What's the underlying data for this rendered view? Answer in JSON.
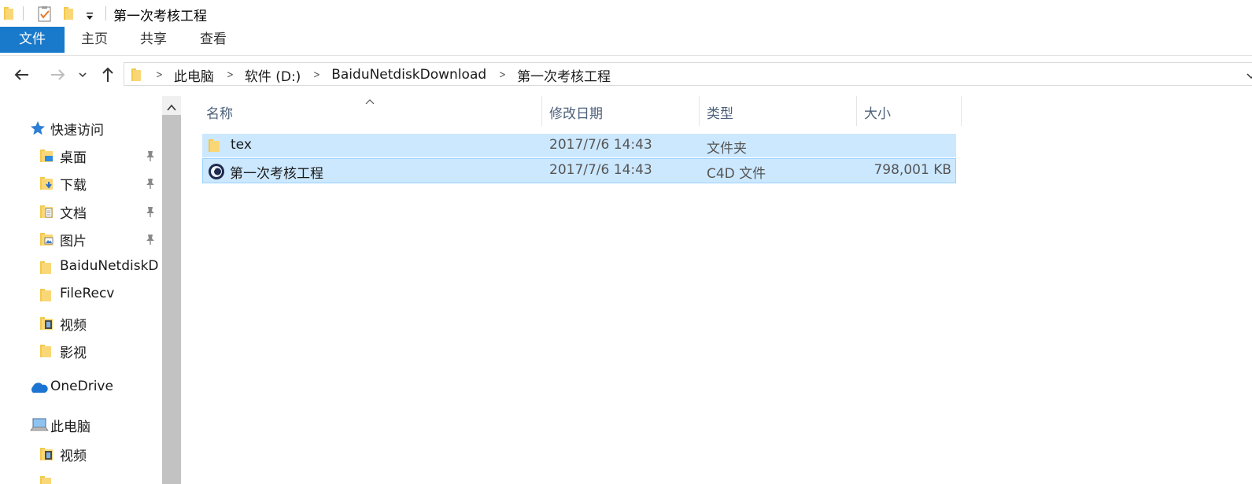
{
  "window": {
    "title": "第一次考核工程",
    "quick_access_toolbar": [
      "folder-icon",
      "properties-icon",
      "new-folder-icon",
      "customize-dropdown-icon"
    ]
  },
  "ribbon": {
    "tabs": [
      "文件",
      "主页",
      "共享",
      "查看"
    ],
    "active_tab": "文件",
    "accent_color": "#1979ca"
  },
  "address_bar": {
    "crumbs": [
      "此电脑",
      "软件 (D:)",
      "BaiduNetdiskDownload",
      "第一次考核工程"
    ]
  },
  "sidebar": {
    "quick_access": {
      "label": "快速访问"
    },
    "items": [
      {
        "label": "桌面",
        "icon": "desktop-folder-icon",
        "pinned": true
      },
      {
        "label": "下载",
        "icon": "downloads-folder-icon",
        "pinned": true
      },
      {
        "label": "文档",
        "icon": "documents-folder-icon",
        "pinned": true
      },
      {
        "label": "图片",
        "icon": "pictures-folder-icon",
        "pinned": true
      },
      {
        "label": "BaiduNetdiskD",
        "icon": "folder-icon",
        "pinned": false
      },
      {
        "label": "FileRecv",
        "icon": "folder-icon",
        "pinned": false
      },
      {
        "label": "视频",
        "icon": "videos-folder-icon",
        "pinned": false
      },
      {
        "label": "影视",
        "icon": "folder-icon",
        "pinned": false
      }
    ],
    "onedrive": {
      "label": "OneDrive"
    },
    "this_pc": {
      "label": "此电脑",
      "children": [
        {
          "label": "视频",
          "icon": "videos-folder-icon"
        }
      ]
    }
  },
  "file_list": {
    "columns": [
      "名称",
      "修改日期",
      "类型",
      "大小"
    ],
    "sorted_by": "名称",
    "rows": [
      {
        "name": "tex",
        "modified": "2017/7/6 14:43",
        "type": "文件夹",
        "size": "",
        "icon": "folder-icon",
        "selected": true
      },
      {
        "name": "第一次考核工程",
        "modified": "2017/7/6 14:43",
        "type": "C4D 文件",
        "size": "798,001 KB",
        "icon": "cinema4d-file-icon",
        "selected": true
      }
    ],
    "selection_color": "#cce8ff",
    "selection_border": "#99d1ff"
  }
}
